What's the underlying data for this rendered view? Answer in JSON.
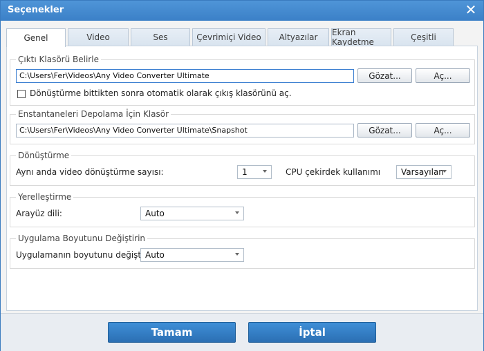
{
  "window": {
    "title": "Seçenekler"
  },
  "tabs": [
    {
      "label": "Genel"
    },
    {
      "label": "Video"
    },
    {
      "label": "Ses"
    },
    {
      "label": "Çevrimiçi Video"
    },
    {
      "label": "Altyazılar"
    },
    {
      "label": "Ekran Kaydetme"
    },
    {
      "label": "Çeşitli"
    }
  ],
  "output": {
    "title": "Çıktı Klasörü Belirle",
    "path": "C:\\Users\\Fer\\Videos\\Any Video Converter Ultimate",
    "browse": "Gözat...",
    "open": "Aç...",
    "checkbox_label": "Dönüştürme bittikten sonra otomatik olarak çıkış klasörünü aç.",
    "checked": false
  },
  "snapshot": {
    "title": "Enstantaneleri Depolama İçin Klasör",
    "path": "C:\\Users\\Fer\\Videos\\Any Video Converter Ultimate\\Snapshot",
    "browse": "Gözat...",
    "open": "Aç..."
  },
  "conversion": {
    "title": "Dönüştürme",
    "concurrent_label": "Aynı anda video dönüştürme sayısı:",
    "concurrent_value": "1",
    "cpu_label": "CPU çekirdek kullanımı",
    "cpu_value": "Varsayılan"
  },
  "localization": {
    "title": "Yerelleştirme",
    "language_label": "Arayüz dili:",
    "language_value": "Auto"
  },
  "resize": {
    "title": "Uygulama Boyutunu Değiştirin",
    "label": "Uygulamanın boyutunu değiştirin:",
    "value": "Auto"
  },
  "footer": {
    "ok": "Tamam",
    "cancel": "İptal"
  }
}
